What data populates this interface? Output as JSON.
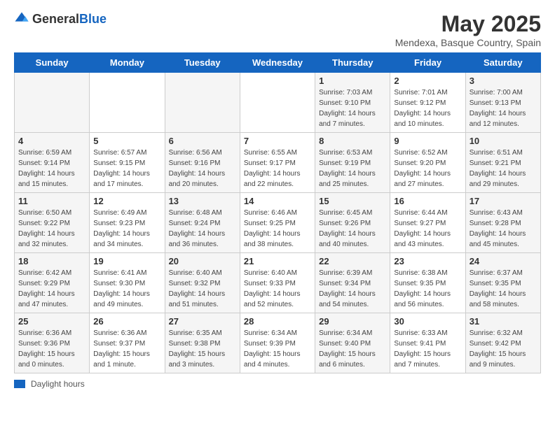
{
  "header": {
    "logo_general": "General",
    "logo_blue": "Blue",
    "title": "May 2025",
    "subtitle": "Mendexa, Basque Country, Spain"
  },
  "days_of_week": [
    "Sunday",
    "Monday",
    "Tuesday",
    "Wednesday",
    "Thursday",
    "Friday",
    "Saturday"
  ],
  "weeks": [
    [
      {
        "date": "",
        "info": ""
      },
      {
        "date": "",
        "info": ""
      },
      {
        "date": "",
        "info": ""
      },
      {
        "date": "",
        "info": ""
      },
      {
        "date": "1",
        "info": "Sunrise: 7:03 AM\nSunset: 9:10 PM\nDaylight: 14 hours\nand 7 minutes."
      },
      {
        "date": "2",
        "info": "Sunrise: 7:01 AM\nSunset: 9:12 PM\nDaylight: 14 hours\nand 10 minutes."
      },
      {
        "date": "3",
        "info": "Sunrise: 7:00 AM\nSunset: 9:13 PM\nDaylight: 14 hours\nand 12 minutes."
      }
    ],
    [
      {
        "date": "4",
        "info": "Sunrise: 6:59 AM\nSunset: 9:14 PM\nDaylight: 14 hours\nand 15 minutes."
      },
      {
        "date": "5",
        "info": "Sunrise: 6:57 AM\nSunset: 9:15 PM\nDaylight: 14 hours\nand 17 minutes."
      },
      {
        "date": "6",
        "info": "Sunrise: 6:56 AM\nSunset: 9:16 PM\nDaylight: 14 hours\nand 20 minutes."
      },
      {
        "date": "7",
        "info": "Sunrise: 6:55 AM\nSunset: 9:17 PM\nDaylight: 14 hours\nand 22 minutes."
      },
      {
        "date": "8",
        "info": "Sunrise: 6:53 AM\nSunset: 9:19 PM\nDaylight: 14 hours\nand 25 minutes."
      },
      {
        "date": "9",
        "info": "Sunrise: 6:52 AM\nSunset: 9:20 PM\nDaylight: 14 hours\nand 27 minutes."
      },
      {
        "date": "10",
        "info": "Sunrise: 6:51 AM\nSunset: 9:21 PM\nDaylight: 14 hours\nand 29 minutes."
      }
    ],
    [
      {
        "date": "11",
        "info": "Sunrise: 6:50 AM\nSunset: 9:22 PM\nDaylight: 14 hours\nand 32 minutes."
      },
      {
        "date": "12",
        "info": "Sunrise: 6:49 AM\nSunset: 9:23 PM\nDaylight: 14 hours\nand 34 minutes."
      },
      {
        "date": "13",
        "info": "Sunrise: 6:48 AM\nSunset: 9:24 PM\nDaylight: 14 hours\nand 36 minutes."
      },
      {
        "date": "14",
        "info": "Sunrise: 6:46 AM\nSunset: 9:25 PM\nDaylight: 14 hours\nand 38 minutes."
      },
      {
        "date": "15",
        "info": "Sunrise: 6:45 AM\nSunset: 9:26 PM\nDaylight: 14 hours\nand 40 minutes."
      },
      {
        "date": "16",
        "info": "Sunrise: 6:44 AM\nSunset: 9:27 PM\nDaylight: 14 hours\nand 43 minutes."
      },
      {
        "date": "17",
        "info": "Sunrise: 6:43 AM\nSunset: 9:28 PM\nDaylight: 14 hours\nand 45 minutes."
      }
    ],
    [
      {
        "date": "18",
        "info": "Sunrise: 6:42 AM\nSunset: 9:29 PM\nDaylight: 14 hours\nand 47 minutes."
      },
      {
        "date": "19",
        "info": "Sunrise: 6:41 AM\nSunset: 9:30 PM\nDaylight: 14 hours\nand 49 minutes."
      },
      {
        "date": "20",
        "info": "Sunrise: 6:40 AM\nSunset: 9:32 PM\nDaylight: 14 hours\nand 51 minutes."
      },
      {
        "date": "21",
        "info": "Sunrise: 6:40 AM\nSunset: 9:33 PM\nDaylight: 14 hours\nand 52 minutes."
      },
      {
        "date": "22",
        "info": "Sunrise: 6:39 AM\nSunset: 9:34 PM\nDaylight: 14 hours\nand 54 minutes."
      },
      {
        "date": "23",
        "info": "Sunrise: 6:38 AM\nSunset: 9:35 PM\nDaylight: 14 hours\nand 56 minutes."
      },
      {
        "date": "24",
        "info": "Sunrise: 6:37 AM\nSunset: 9:35 PM\nDaylight: 14 hours\nand 58 minutes."
      }
    ],
    [
      {
        "date": "25",
        "info": "Sunrise: 6:36 AM\nSunset: 9:36 PM\nDaylight: 15 hours\nand 0 minutes."
      },
      {
        "date": "26",
        "info": "Sunrise: 6:36 AM\nSunset: 9:37 PM\nDaylight: 15 hours\nand 1 minute."
      },
      {
        "date": "27",
        "info": "Sunrise: 6:35 AM\nSunset: 9:38 PM\nDaylight: 15 hours\nand 3 minutes."
      },
      {
        "date": "28",
        "info": "Sunrise: 6:34 AM\nSunset: 9:39 PM\nDaylight: 15 hours\nand 4 minutes."
      },
      {
        "date": "29",
        "info": "Sunrise: 6:34 AM\nSunset: 9:40 PM\nDaylight: 15 hours\nand 6 minutes."
      },
      {
        "date": "30",
        "info": "Sunrise: 6:33 AM\nSunset: 9:41 PM\nDaylight: 15 hours\nand 7 minutes."
      },
      {
        "date": "31",
        "info": "Sunrise: 6:32 AM\nSunset: 9:42 PM\nDaylight: 15 hours\nand 9 minutes."
      }
    ]
  ],
  "legend": {
    "box_color": "#1565c0",
    "label": "Daylight hours"
  }
}
